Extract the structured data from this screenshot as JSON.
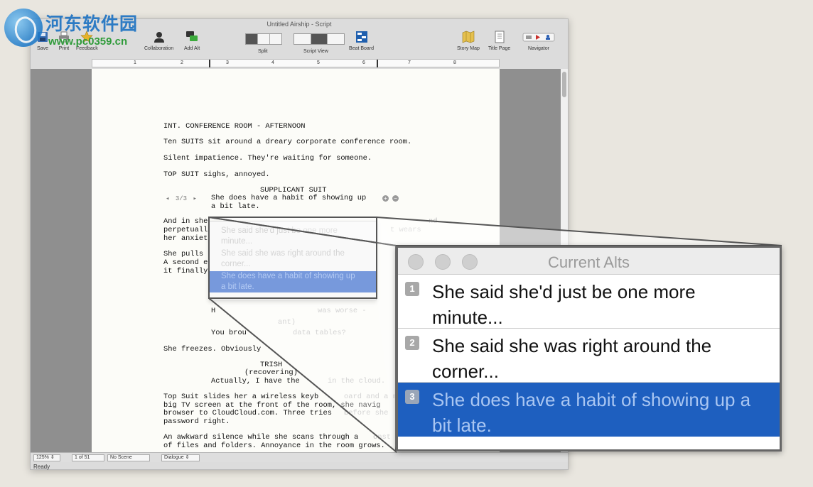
{
  "watermark": {
    "title": "河东软件园",
    "url": "www.pc0359.cn"
  },
  "window": {
    "title": "Untitled Airship - Script"
  },
  "toolbar": {
    "save": "Save",
    "print": "Print",
    "feedback": "Feedback",
    "collaboration": "Collaboration",
    "add_alt": "Add Alt",
    "split": "Split",
    "script_view": "Script View",
    "beat_board": "Beat Board",
    "story_map": "Story Map",
    "title_page": "Title Page",
    "navigator": "Navigator"
  },
  "ruler": {
    "numbers": [
      "1",
      "2",
      "3",
      "4",
      "5",
      "6",
      "7",
      "8"
    ]
  },
  "script": {
    "slug": "INT. CONFERENCE ROOM - AFTERNOON",
    "action1": "Ten SUITS sit around a dreary corporate conference room.",
    "action2": "Silent impatience. They're waiting for someone.",
    "action3": "TOP SUIT sighs, annoyed.",
    "character1": "SUPPLICANT SUIT",
    "alt_nav": "3/3",
    "dialogue1_line1": "She does have a habit of showing up",
    "dialogue1_line2": "a bit late.",
    "action4_l1": "And in she",
    "action4_l2": "perpetuall",
    "action4_l3": "her anxiet",
    "action4_right_l1": "nd",
    "action4_right_l2": "t wears",
    "action5_l1": "She pulls",
    "action5_l2": "A second e",
    "action5_l3": "it finally",
    "action6_l1": "H",
    "action6_l1_faint": "was worse -",
    "action6_l2_faint": "ant)",
    "dialogue2": "You brou",
    "dialogue2_faint": "data tables?",
    "action7": "She freezes. Obviously",
    "character2": "TRISH",
    "paren2": "(recovering)",
    "dialogue3": "Actually, I have the",
    "dialogue3_faint": "in the cloud.",
    "action8_l1": "Top Suit slides her a wireless keyb",
    "action8_l1_faint": "oard and a mous",
    "action8_l2": "big TV screen at the front of the room, she navig",
    "action8_l3": "browser to CloudCloud.com. Three tries",
    "action8_l3_faint": "before she",
    "action8_l4": "password right.",
    "action9_l1": "An awkward silence while she scans through a",
    "action9_l1_faint": "onst",
    "action9_l2": "of files and folders. Annoyance in the room grows."
  },
  "popup_alts": [
    "She said she'd just be one more",
    "minute...",
    "She said she was right around the",
    "corner...",
    "She does have a habit of showing up",
    "a bit late."
  ],
  "statusbar": {
    "zoom": "125%",
    "page": "1 of 51",
    "scene": "No Scene",
    "element": "Dialogue",
    "status": "Ready"
  },
  "current_alts": {
    "title": "Current Alts",
    "items": [
      {
        "num": "1",
        "text": "She said she'd just be one more minute...",
        "selected": false
      },
      {
        "num": "2",
        "text": "She said she was right around the corner...",
        "selected": false
      },
      {
        "num": "3",
        "text": "She does have a habit of showing up a bit late.",
        "selected": true
      }
    ]
  },
  "colors": {
    "selection": "#1e5fbf",
    "page": "#fcfcf8",
    "gutter": "#8f8f8f"
  }
}
